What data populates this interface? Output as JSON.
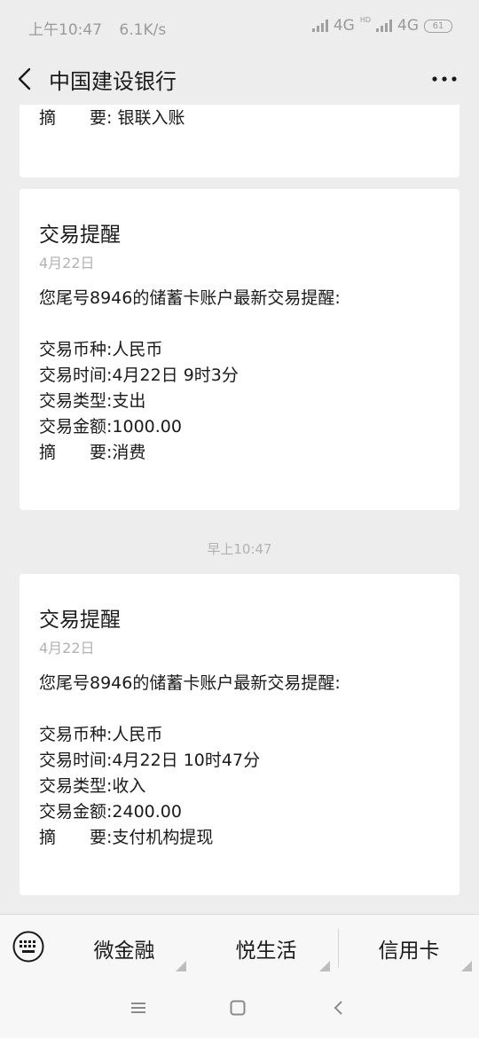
{
  "status": {
    "time": "上午10:47",
    "speed": "6.1K/s",
    "net1": "4G",
    "hd": "HD",
    "net2": "4G",
    "battery": "61"
  },
  "header": {
    "title": "中国建设银行"
  },
  "partial_card": {
    "summary_key": "摘　　要:",
    "summary_val": "银联入账"
  },
  "cards": [
    {
      "title": "交易提醒",
      "date": "4月22日",
      "intro": "您尾号8946的储蓄卡账户最新交易提醒:",
      "currency_key": "交易币种:",
      "currency_val": "人民币",
      "time_key": "交易时间:",
      "time_val": "4月22日 9时3分",
      "type_key": "交易类型:",
      "type_val": "支出",
      "amount_key": "交易金额:",
      "amount_val": "1000.00",
      "summary_key": "摘　　要:",
      "summary_val": "消费"
    },
    {
      "title": "交易提醒",
      "date": "4月22日",
      "intro": "您尾号8946的储蓄卡账户最新交易提醒:",
      "currency_key": "交易币种:",
      "currency_val": "人民币",
      "time_key": "交易时间:",
      "time_val": "4月22日 10时47分",
      "type_key": "交易类型:",
      "type_val": "收入",
      "amount_key": "交易金额:",
      "amount_val": "2400.00",
      "summary_key": "摘　　要:",
      "summary_val": "支付机构提现"
    }
  ],
  "timestamp": "早上10:47",
  "menu": {
    "items": [
      "微金融",
      "悦生活",
      "信用卡"
    ]
  },
  "icons": {
    "back": "chevron-left-icon",
    "more": "more-dots-icon",
    "keyboard": "keyboard-icon",
    "nav_menu": "menu-lines-icon",
    "nav_home": "home-square-icon",
    "nav_back": "back-chevron-icon"
  },
  "colors": {
    "background": "#ededed",
    "card": "#ffffff",
    "muted": "#b2b2b2"
  }
}
